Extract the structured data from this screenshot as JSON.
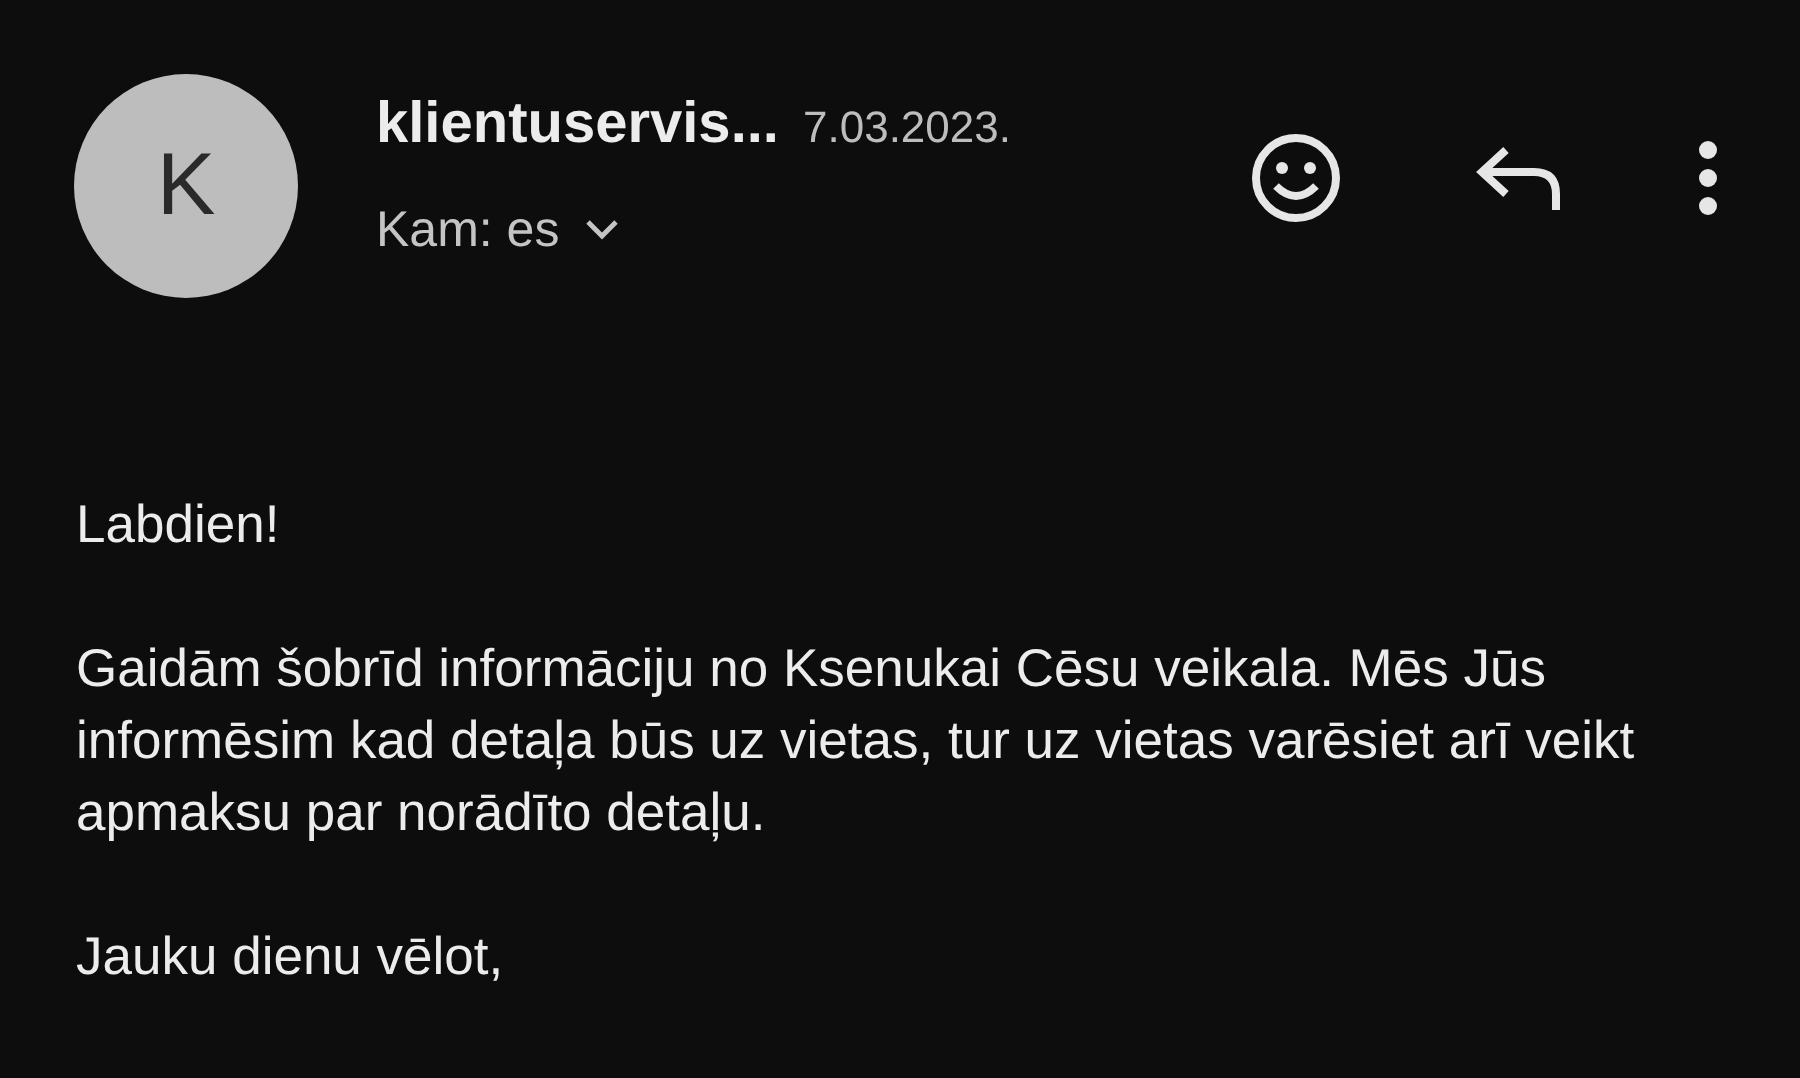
{
  "sender": {
    "avatar_letter": "K",
    "name": "klientuservis...",
    "date": "7.03.2023."
  },
  "recipient": {
    "label": "Kam: es",
    "expanded": false
  },
  "body": {
    "greeting": "Labdien!",
    "paragraph": "Gaidām šobrīd informāciju no Ksenukai Cēsu veikala. Mēs Jūs informēsim kad detaļa būs uz vietas, tur uz vietas varēsiet arī veikt apmaksu par norādīto detaļu.",
    "closing": "Jauku dienu vēlot,"
  }
}
